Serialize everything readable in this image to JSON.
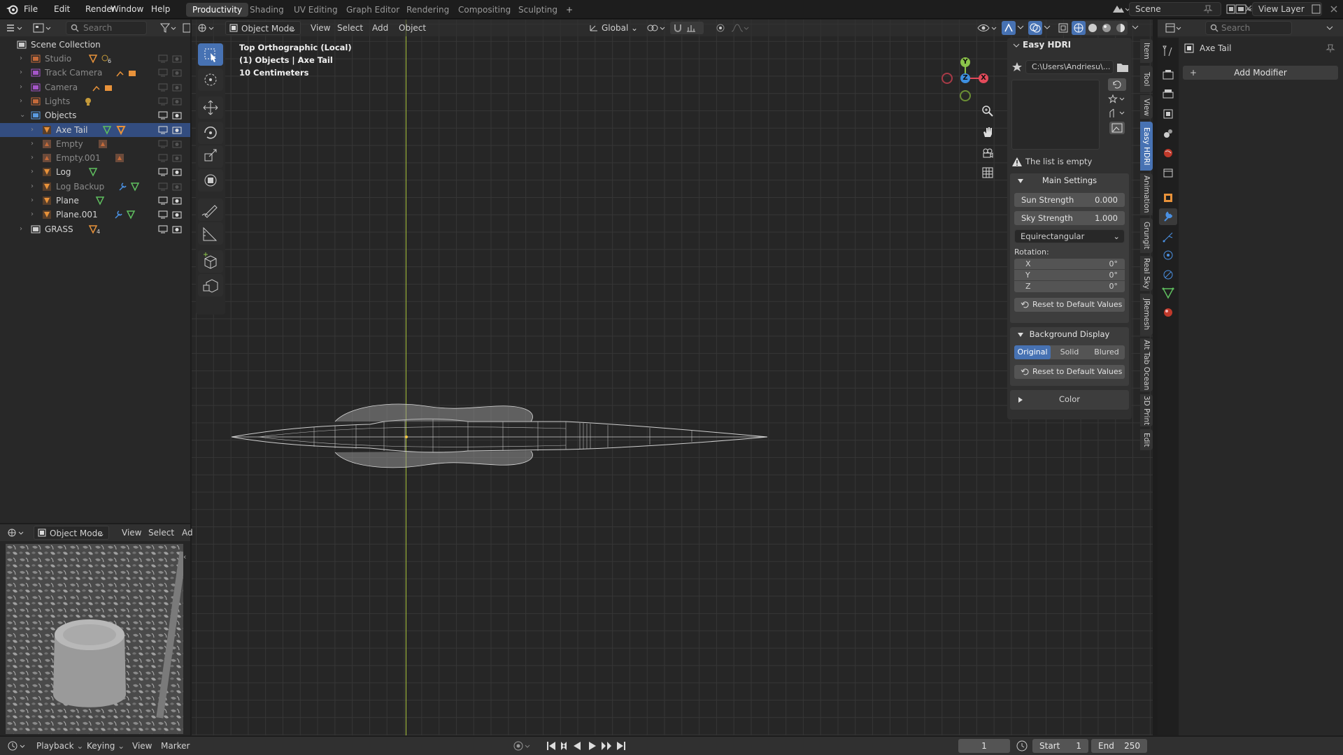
{
  "topbar": {
    "menus": [
      "File",
      "Edit",
      "Render",
      "Window",
      "Help"
    ],
    "workspaces": [
      "Productivity",
      "Shading",
      "UV Editing",
      "Graph Editor",
      "Rendering",
      "Compositing",
      "Sculpting"
    ],
    "add_tab": "+",
    "scene_name": "Scene",
    "view_layer": "View Layer"
  },
  "outliner": {
    "search_placeholder": "Search",
    "root": "Scene Collection",
    "rows": [
      {
        "label": "Studio",
        "dim": true,
        "indent": 0,
        "icon_color": "#c46a3a"
      },
      {
        "label": "Track Camera",
        "dim": true,
        "indent": 0,
        "icon_color": "#a556c9"
      },
      {
        "label": "Camera",
        "dim": true,
        "indent": 0,
        "icon_color": "#a556c9"
      },
      {
        "label": "Lights",
        "dim": true,
        "indent": 0,
        "icon_color": "#c46a3a"
      },
      {
        "label": "Objects",
        "dim": false,
        "indent": 0,
        "icon_color": "#5a9be0"
      },
      {
        "label": "Axe Tail",
        "dim": false,
        "indent": 1,
        "icon_color": "#e8923a",
        "selected": true
      },
      {
        "label": "Empty",
        "dim": true,
        "indent": 1,
        "icon_color": "#c46a3a"
      },
      {
        "label": "Empty.001",
        "dim": true,
        "indent": 1,
        "icon_color": "#c46a3a"
      },
      {
        "label": "Log",
        "dim": false,
        "indent": 1,
        "icon_color": "#e8923a"
      },
      {
        "label": "Log Backup",
        "dim": true,
        "indent": 1,
        "icon_color": "#e8923a"
      },
      {
        "label": "Plane",
        "dim": false,
        "indent": 1,
        "icon_color": "#e8923a"
      },
      {
        "label": "Plane.001",
        "dim": false,
        "indent": 1,
        "icon_color": "#e8923a"
      },
      {
        "label": "GRASS",
        "dim": false,
        "indent": 0,
        "icon_color": "#d0d0d0"
      }
    ],
    "badge_studio": "6",
    "badge_grass": "4"
  },
  "viewport_header": {
    "mode": "Object Mode",
    "menus": [
      "View",
      "Select",
      "Add",
      "Object"
    ],
    "orientation": "Global"
  },
  "viewport_overlay": {
    "line1": "Top Orthographic (Local)",
    "line2": "(1) Objects | Axe Tail",
    "line3": "10 Centimeters"
  },
  "gizmo": {
    "y": "Y",
    "z": "Z",
    "x": "X"
  },
  "easy_hdri": {
    "title": "Easy HDRI",
    "path": "C:\\Users\\Andriesu\\...",
    "empty_msg": "The list is empty",
    "main_settings": "Main Settings",
    "sun_label": "Sun Strength",
    "sun_value": "0.000",
    "sky_label": "Sky Strength",
    "sky_value": "1.000",
    "projection": "Equirectangular",
    "rotation_label": "Rotation:",
    "rot_x_label": "X",
    "rot_x": "0°",
    "rot_y_label": "Y",
    "rot_y": "0°",
    "rot_z_label": "Z",
    "rot_z": "0°",
    "reset": "Reset to Default Values",
    "bg_display": "Background Display",
    "bg_options": [
      "Original",
      "Solid",
      "Blured"
    ],
    "bg_selected": "Original",
    "color": "Color"
  },
  "side_tabs": [
    "Item",
    "Tool",
    "View",
    "Easy HDRI",
    "Animation",
    "Grungit",
    "Real Sky",
    "JRemesh",
    "Alt Tab Ocean",
    "3D Print",
    "Edit"
  ],
  "properties": {
    "search_placeholder": "Search",
    "object_name": "Axe Tail",
    "add_modifier": "Add Modifier"
  },
  "preview_header": {
    "mode": "Object Mode",
    "menus": [
      "View",
      "Select",
      "Ad"
    ]
  },
  "timeline": {
    "menus": [
      "Playback",
      "Keying",
      "View",
      "Marker"
    ],
    "current_frame": "1",
    "start_label": "Start",
    "start": "1",
    "end_label": "End",
    "end": "250"
  },
  "colors": {
    "accent": "#4772b3",
    "x_axis": "#e34a5a",
    "y_axis": "#8bc34a",
    "z_axis": "#3d8fe0"
  }
}
